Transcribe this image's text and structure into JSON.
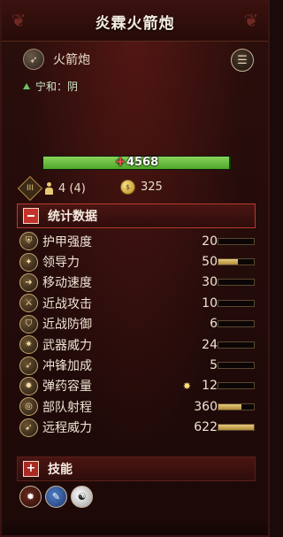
{
  "header": {
    "title": "炎霖火箭炮"
  },
  "unit": {
    "name": "火箭炮",
    "icon": "rocket-icon"
  },
  "menu": {
    "icon": "menu-icon"
  },
  "faction": {
    "label": "宁和：阴"
  },
  "health": {
    "value": "4568",
    "fill_fraction": 0.99,
    "color": "#6cc13f"
  },
  "info": {
    "men": "4 (4)",
    "cost": "325",
    "rank": "III"
  },
  "stats_section": {
    "title": "统计数据"
  },
  "stats": [
    {
      "label": "护甲强度",
      "value": "20",
      "extra": "",
      "bar": 0.0,
      "icon": "armor-icon"
    },
    {
      "label": "领导力",
      "value": "50",
      "extra": "",
      "bar": 0.55,
      "icon": "leadership-icon"
    },
    {
      "label": "移动速度",
      "value": "30",
      "extra": "",
      "bar": 0.0,
      "icon": "speed-icon"
    },
    {
      "label": "近战攻击",
      "value": "10",
      "extra": "",
      "bar": 0.0,
      "icon": "melee-attack-icon"
    },
    {
      "label": "近战防御",
      "value": "6",
      "extra": "",
      "bar": 0.0,
      "icon": "melee-defense-icon"
    },
    {
      "label": "武器威力",
      "value": "24",
      "extra": "",
      "bar": 0.0,
      "icon": "weapon-strength-icon"
    },
    {
      "label": "冲锋加成",
      "value": "5",
      "extra": "",
      "bar": 0.0,
      "icon": "charge-bonus-icon"
    },
    {
      "label": "弹药容量",
      "value": "12",
      "extra": "✸",
      "bar": 0.0,
      "icon": "ammo-icon"
    },
    {
      "label": "部队射程",
      "value": "360",
      "extra": "",
      "bar": 0.65,
      "icon": "range-icon"
    },
    {
      "label": "远程威力",
      "value": "622",
      "extra": "",
      "bar": 1.0,
      "icon": "missile-strength-icon"
    }
  ],
  "skills_section": {
    "title": "技能"
  },
  "abilities": [
    {
      "icon": "ability-fire-icon"
    },
    {
      "icon": "ability-blue-icon"
    },
    {
      "icon": "ability-yinyang-icon"
    }
  ]
}
